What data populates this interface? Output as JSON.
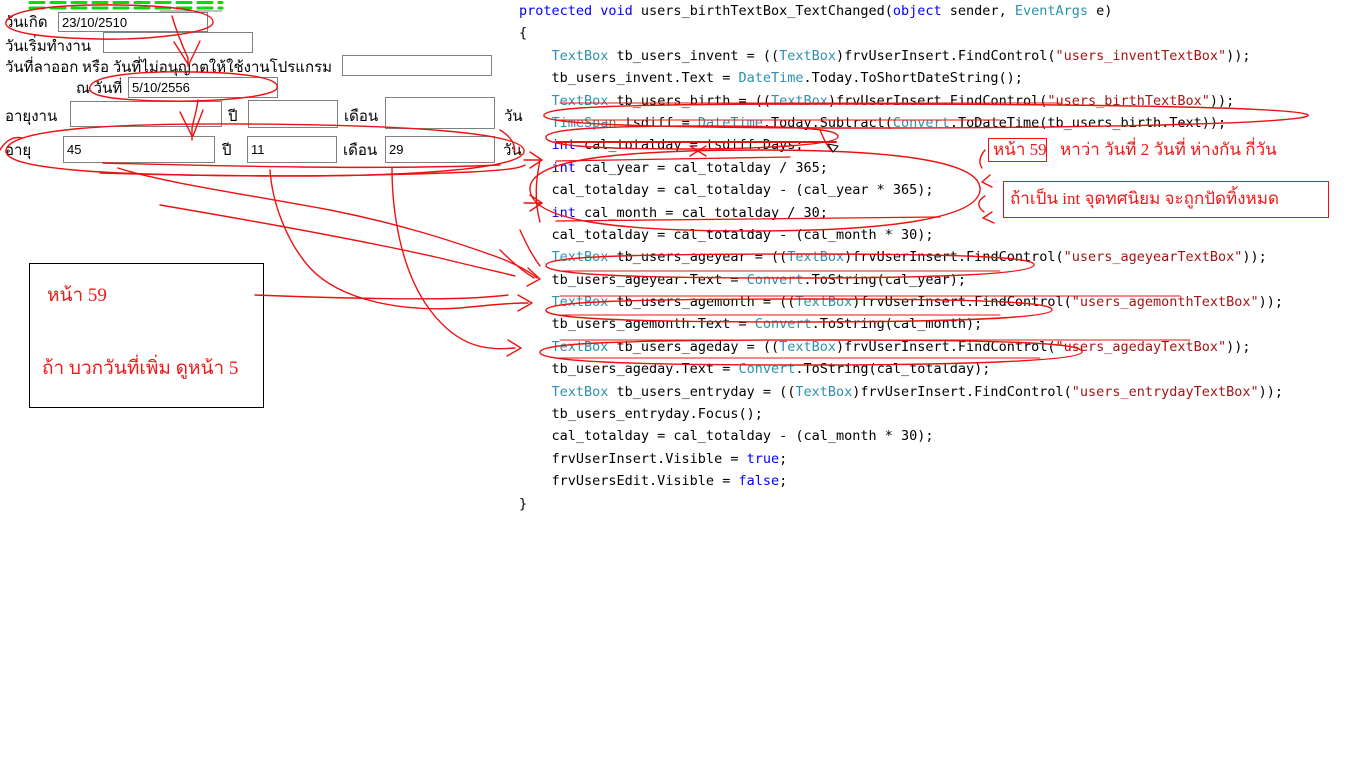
{
  "form": {
    "fields": [
      {
        "label": "วันเกิด",
        "value": "23/10/2510"
      },
      {
        "label": "วันเริ่มทำงาน",
        "value": ""
      },
      {
        "label": "วันที่ลาออก หรือ วันที่ไม่อนุญาตให้ใช้งานโปรแกรม",
        "value": ""
      },
      {
        "label": "ณ วันที่",
        "value": "5/10/2556"
      }
    ],
    "worklife": {
      "label": "อายุงาน",
      "year_value": "",
      "year_unit": "ปี",
      "month_value": "",
      "month_unit": "เดือน",
      "day_value": "",
      "day_unit": "วัน"
    },
    "age": {
      "label": "อายุ",
      "year_value": "45",
      "year_unit": "ปี",
      "month_value": "11",
      "month_unit": "เดือน",
      "day_value": "29",
      "day_unit": "วัน"
    }
  },
  "notes": {
    "left_box": {
      "line1": "หน้า 59",
      "line2": "ถ้า บวกวันที่เพิ่ม ดูหน้า 5"
    },
    "page59_badge": "หน้า 59",
    "page59_text": "หาว่า วันที่ 2 วันที่ ห่างกัน กี่วัน",
    "int_box": "ถ้าเป็น int จุดทศนิยม จะถูกปัดทิ้งหมด"
  },
  "colors": {
    "keyword": "#0000ff",
    "type": "#2b91af",
    "string": "#a31515",
    "annotation": "#ee1111",
    "annotation_text": "#f01818",
    "dashed_green": "#00dd00",
    "field_border": "#808080"
  },
  "code": {
    "lines": [
      [
        {
          "t": "protected ",
          "c": "kw"
        },
        {
          "t": "void ",
          "c": "kw"
        },
        {
          "t": "users_birthTextBox_TextChanged(",
          "c": "pl"
        },
        {
          "t": "object",
          "c": "kw"
        },
        {
          "t": " sender, ",
          "c": "pl"
        },
        {
          "t": "EventArgs",
          "c": "typ"
        },
        {
          "t": " e)",
          "c": "pl"
        }
      ],
      [
        {
          "t": "{",
          "c": "pl"
        }
      ],
      [
        {
          "t": "    ",
          "c": "pl"
        },
        {
          "t": "TextBox",
          "c": "typ"
        },
        {
          "t": " tb_users_invent = ((",
          "c": "pl"
        },
        {
          "t": "TextBox",
          "c": "typ"
        },
        {
          "t": ")frvUserInsert.FindControl(",
          "c": "pl"
        },
        {
          "t": "\"users_inventTextBox\"",
          "c": "str"
        },
        {
          "t": "));",
          "c": "pl"
        }
      ],
      [
        {
          "t": "    tb_users_invent.Text = ",
          "c": "pl"
        },
        {
          "t": "DateTime",
          "c": "typ"
        },
        {
          "t": ".Today.ToShortDateString();",
          "c": "pl"
        }
      ],
      [
        {
          "t": "    ",
          "c": "pl"
        },
        {
          "t": "TextBox",
          "c": "typ"
        },
        {
          "t": " tb_users_birth = ((",
          "c": "pl"
        },
        {
          "t": "TextBox",
          "c": "typ"
        },
        {
          "t": ")frvUserInsert.FindControl(",
          "c": "pl"
        },
        {
          "t": "\"users_birthTextBox\"",
          "c": "str"
        },
        {
          "t": "));",
          "c": "pl"
        }
      ],
      [
        {
          "t": "    ",
          "c": "pl"
        },
        {
          "t": "TimeSpan",
          "c": "typ"
        },
        {
          "t": " tsdiff = ",
          "c": "pl"
        },
        {
          "t": "DateTime",
          "c": "typ"
        },
        {
          "t": ".Today.Subtract(",
          "c": "pl"
        },
        {
          "t": "Convert",
          "c": "typ"
        },
        {
          "t": ".ToDateTime(tb_users_birth.Text));",
          "c": "pl"
        }
      ],
      [
        {
          "t": "    ",
          "c": "pl"
        },
        {
          "t": "int",
          "c": "kw"
        },
        {
          "t": " cal_totalday = tsdiff.Days;",
          "c": "pl"
        }
      ],
      [
        {
          "t": "    ",
          "c": "pl"
        },
        {
          "t": "int",
          "c": "kw"
        },
        {
          "t": " cal_year = cal_totalday / 365;",
          "c": "pl"
        }
      ],
      [
        {
          "t": "    cal_totalday = cal_totalday - (cal_year * 365);",
          "c": "pl"
        }
      ],
      [
        {
          "t": "    ",
          "c": "pl"
        },
        {
          "t": "int",
          "c": "kw"
        },
        {
          "t": " cal_month = cal_totalday / 30;",
          "c": "pl"
        }
      ],
      [
        {
          "t": "    cal_totalday = cal_totalday - (cal_month * 30);",
          "c": "pl"
        }
      ],
      [
        {
          "t": "    ",
          "c": "pl"
        },
        {
          "t": "TextBox",
          "c": "typ"
        },
        {
          "t": " tb_users_ageyear = ((",
          "c": "pl"
        },
        {
          "t": "TextBox",
          "c": "typ"
        },
        {
          "t": ")frvUserInsert.FindControl(",
          "c": "pl"
        },
        {
          "t": "\"users_ageyearTextBox\"",
          "c": "str"
        },
        {
          "t": "));",
          "c": "pl"
        }
      ],
      [
        {
          "t": "    tb_users_ageyear.Text = ",
          "c": "pl"
        },
        {
          "t": "Convert",
          "c": "typ"
        },
        {
          "t": ".ToString(cal_year);",
          "c": "pl"
        }
      ],
      [
        {
          "t": "    ",
          "c": "pl"
        },
        {
          "t": "TextBox",
          "c": "typ"
        },
        {
          "t": " tb_users_agemonth = ((",
          "c": "pl"
        },
        {
          "t": "TextBox",
          "c": "typ"
        },
        {
          "t": ")frvUserInsert.FindControl(",
          "c": "pl"
        },
        {
          "t": "\"users_agemonthTextBox\"",
          "c": "str"
        },
        {
          "t": "));",
          "c": "pl"
        }
      ],
      [
        {
          "t": "    tb_users_agemonth.Text = ",
          "c": "pl"
        },
        {
          "t": "Convert",
          "c": "typ"
        },
        {
          "t": ".ToString(cal_month);",
          "c": "pl"
        }
      ],
      [
        {
          "t": "    ",
          "c": "pl"
        },
        {
          "t": "TextBox",
          "c": "typ"
        },
        {
          "t": " tb_users_ageday = ((",
          "c": "pl"
        },
        {
          "t": "TextBox",
          "c": "typ"
        },
        {
          "t": ")frvUserInsert.FindControl(",
          "c": "pl"
        },
        {
          "t": "\"users_agedayTextBox\"",
          "c": "str"
        },
        {
          "t": "));",
          "c": "pl"
        }
      ],
      [
        {
          "t": "    tb_users_ageday.Text = ",
          "c": "pl"
        },
        {
          "t": "Convert",
          "c": "typ"
        },
        {
          "t": ".ToString(cal_totalday);",
          "c": "pl"
        }
      ],
      [
        {
          "t": "    ",
          "c": "pl"
        },
        {
          "t": "TextBox",
          "c": "typ"
        },
        {
          "t": " tb_users_entryday = ((",
          "c": "pl"
        },
        {
          "t": "TextBox",
          "c": "typ"
        },
        {
          "t": ")frvUserInsert.FindControl(",
          "c": "pl"
        },
        {
          "t": "\"users_entrydayTextBox\"",
          "c": "str"
        },
        {
          "t": "));",
          "c": "pl"
        }
      ],
      [
        {
          "t": "    tb_users_entryday.Focus();",
          "c": "pl"
        }
      ],
      [
        {
          "t": "    cal_totalday = cal_totalday - (cal_month * 30);",
          "c": "pl"
        }
      ],
      [
        {
          "t": "    frvUserInsert.Visible = ",
          "c": "pl"
        },
        {
          "t": "true",
          "c": "kw"
        },
        {
          "t": ";",
          "c": "pl"
        }
      ],
      [
        {
          "t": "    frvUsersEdit.Visible = ",
          "c": "pl"
        },
        {
          "t": "false",
          "c": "kw"
        },
        {
          "t": ";",
          "c": "pl"
        }
      ],
      [
        {
          "t": "}",
          "c": "pl"
        }
      ]
    ]
  }
}
